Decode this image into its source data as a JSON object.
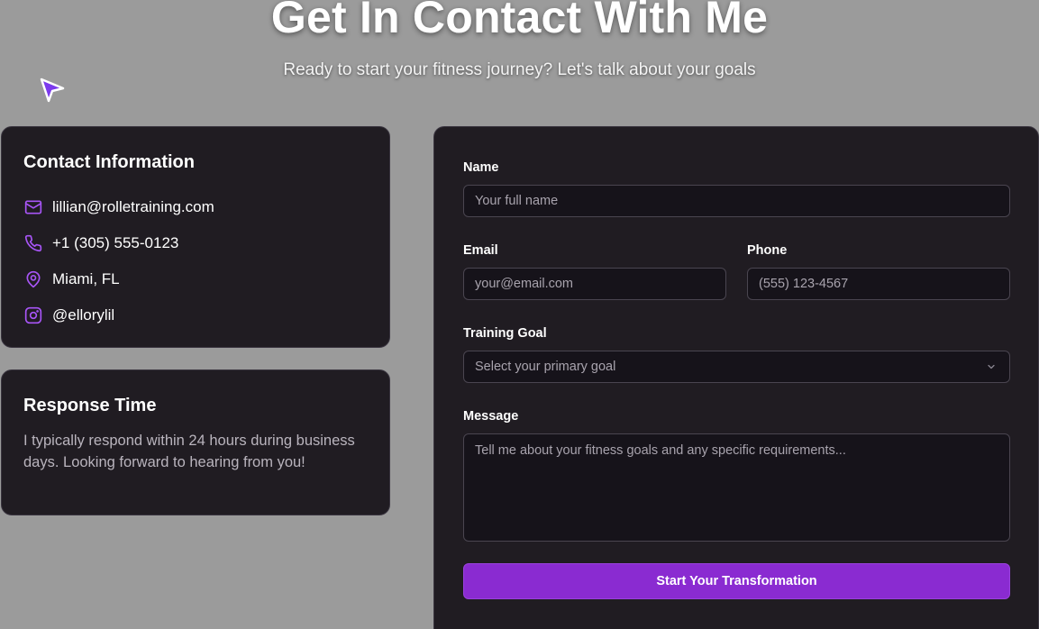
{
  "hero": {
    "title": "Get In Contact With Me",
    "subtitle": "Ready to start your fitness journey? Let's talk about your goals"
  },
  "contact_info": {
    "title": "Contact Information",
    "items": [
      {
        "icon": "mail-icon",
        "text": "lillian@rolletraining.com"
      },
      {
        "icon": "phone-icon",
        "text": "+1 (305) 555-0123"
      },
      {
        "icon": "location-pin-icon",
        "text": "Miami, FL"
      },
      {
        "icon": "instagram-icon",
        "text": "@ellorylil"
      }
    ]
  },
  "response_time": {
    "title": "Response Time",
    "text": "I typically respond within 24 hours during business days. Looking forward to hearing from you!"
  },
  "form": {
    "name_label": "Name",
    "name_placeholder": "Your full name",
    "email_label": "Email",
    "email_placeholder": "your@email.com",
    "phone_label": "Phone",
    "phone_placeholder": "(555) 123-4567",
    "goal_label": "Training Goal",
    "goal_placeholder": "Select your primary goal",
    "message_label": "Message",
    "message_placeholder": "Tell me about your fitness goals and any specific requirements...",
    "submit_label": "Start Your Transformation"
  },
  "colors": {
    "accent": "#8a2bd1",
    "icon": "#a855f7",
    "card_bg": "#201c22",
    "page_bg": "#9b9b9b"
  }
}
